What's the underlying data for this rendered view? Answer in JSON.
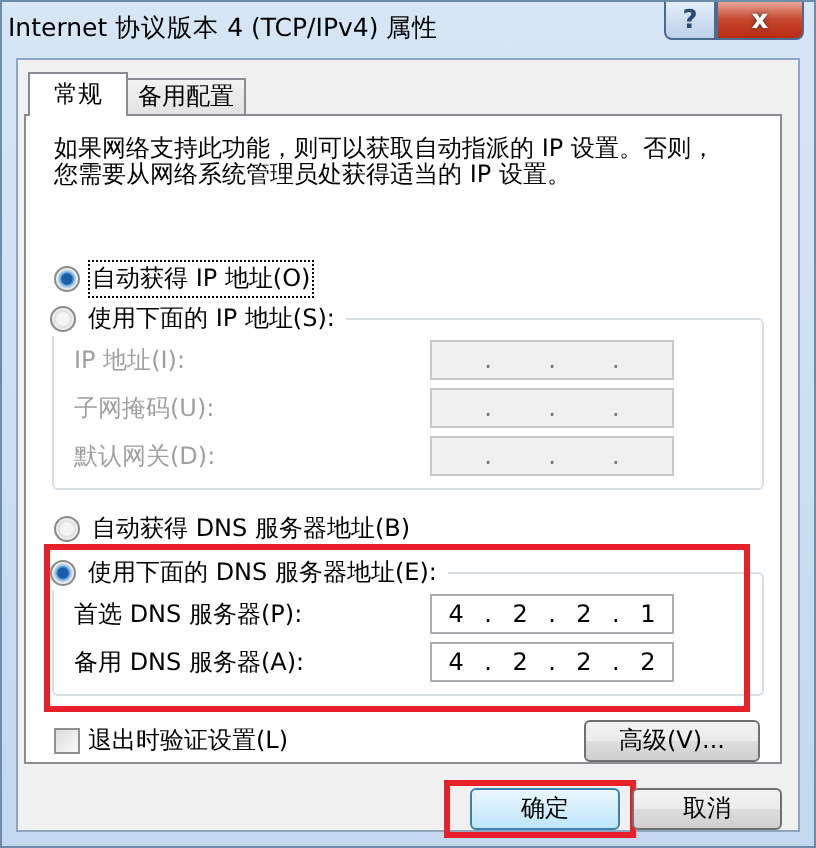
{
  "window": {
    "title": "Internet 协议版本 4 (TCP/IPv4) 属性",
    "help_button": "?",
    "close_button": "x"
  },
  "tabs": [
    {
      "label": "常规",
      "selected": true
    },
    {
      "label": "备用配置",
      "selected": false
    }
  ],
  "description": "如果网络支持此功能，则可以获取自动指派的 IP 设置。否则，您需要从网络系统管理员处获得适当的 IP 设置。",
  "octet_separator": ".",
  "ip_section": {
    "auto_option": {
      "label": "自动获得 IP 地址(O)",
      "selected": true,
      "focused": true
    },
    "manual_option": {
      "label": "使用下面的 IP 地址(S):",
      "selected": false
    },
    "disabled": true,
    "fields": [
      {
        "label": "IP 地址(I):"
      },
      {
        "label": "子网掩码(U):"
      },
      {
        "label": "默认网关(D):"
      }
    ]
  },
  "dns_section": {
    "highlighted": true,
    "auto_option": {
      "label": "自动获得 DNS 服务器地址(B)",
      "selected": false,
      "focused": false
    },
    "manual_option": {
      "label": "使用下面的 DNS 服务器地址(E):",
      "selected": true
    },
    "disabled": false,
    "fields": [
      {
        "label": "首选 DNS 服务器(P):",
        "octets": [
          "4",
          "2",
          "2",
          "1"
        ]
      },
      {
        "label": "备用 DNS 服务器(A):",
        "octets": [
          "4",
          "2",
          "2",
          "2"
        ]
      }
    ]
  },
  "validate_checkbox": {
    "label": "退出时验证设置(L)",
    "checked": false
  },
  "advanced_button": "高级(V)...",
  "buttons": [
    {
      "label": "确定",
      "default": true,
      "highlighted": true
    },
    {
      "label": "取消",
      "default": false,
      "highlighted": false
    }
  ]
}
